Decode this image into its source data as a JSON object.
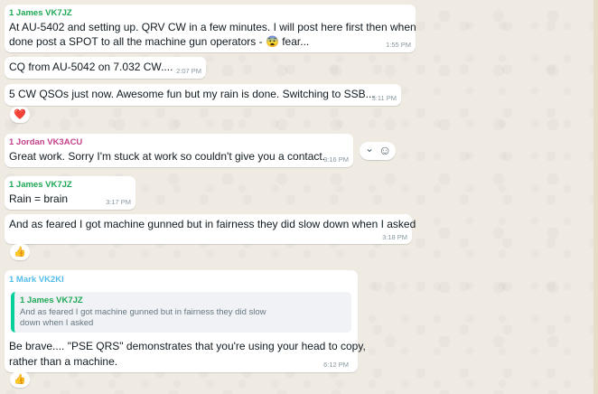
{
  "messages": [
    {
      "sender": "1 James VK7JZ",
      "sender_color": "#1fa855",
      "lines": [
        "At AU-5402 and setting up.  QRV CW in a few minutes.  I will post here first then when",
        "done post a SPOT to all the machine gun operators - 😨 fear..."
      ],
      "time": "1:55 PM"
    },
    {
      "lines": [
        "CQ from AU-5042 on 7.032 CW...."
      ],
      "time": "2:07 PM"
    },
    {
      "lines": [
        "5 CW QSOs just now.  Awesome fun but my rain is done.  Switching to SSB..."
      ],
      "time": "3:11 PM",
      "reaction": "❤️"
    },
    {
      "sender": "1 Jordan VK3ACU",
      "sender_color": "#c4418a",
      "lines": [
        "Great work. Sorry I'm stuck at work so couldn't give you a contact."
      ],
      "time": "3:16 PM"
    },
    {
      "sender": "1 James VK7JZ",
      "sender_color": "#1fa855",
      "lines": [
        "Rain = brain"
      ],
      "time": "3:17 PM"
    },
    {
      "lines": [
        "And as feared I got machine gunned but in fairness they did slow down when I asked"
      ],
      "time": "3:18 PM",
      "reaction": "👍"
    },
    {
      "sender": "1 Mark VK2KI",
      "sender_color": "#53bdeb",
      "quote": {
        "sender": "1 James VK7JZ",
        "lines": [
          "And as feared I got machine gunned but in fairness they did slow",
          "down when I asked"
        ]
      },
      "lines": [
        "Be brave.... \"PSE QRS\" demonstrates that you're using your head to copy,",
        "rather than a machine."
      ],
      "time": "6:12 PM",
      "reaction": "👍"
    }
  ],
  "hover_controls": {
    "chevron": "⌄",
    "emoji": "☺"
  },
  "icons": [
    "chevron-down-icon",
    "emoji-icon"
  ]
}
